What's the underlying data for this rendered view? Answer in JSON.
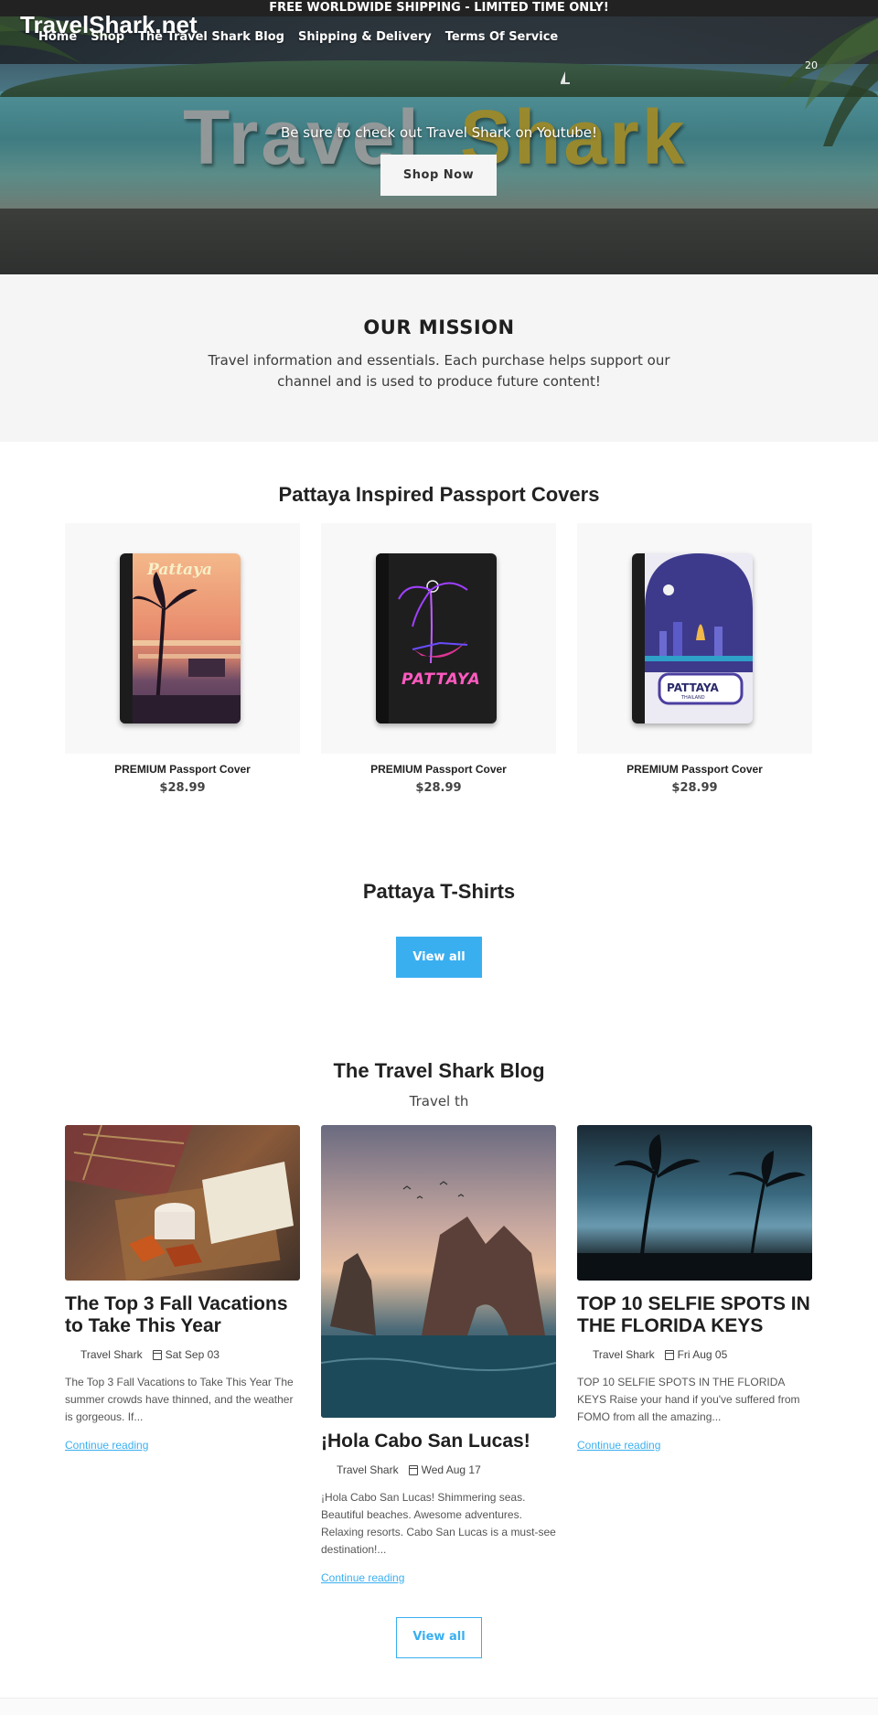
{
  "announcement": "FREE WORLDWIDE SHIPPING - LIMITED TIME ONLY!",
  "header": {
    "logo": "TravelShark.net",
    "nav": [
      "Home",
      "Shop",
      "The Travel Shark Blog",
      "Shipping & Delivery",
      "Terms Of Service"
    ],
    "cart_count": "20"
  },
  "hero": {
    "bg_text_1": "Travel",
    "bg_text_2": "Shark",
    "subtitle": "Be sure to check out Travel Shark on Youtube!",
    "button": "Shop Now"
  },
  "mission": {
    "title": "OUR MISSION",
    "text": "Travel information and essentials. Each purchase helps support our channel and is used to produce future content!"
  },
  "passport_section": {
    "title": "Pattaya Inspired Passport Covers",
    "products": [
      {
        "name": "PREMIUM Passport Cover",
        "price": "$28.99",
        "cover_text": "Pattaya"
      },
      {
        "name": "PREMIUM Passport Cover",
        "price": "$28.99",
        "cover_text": "PATTAYA"
      },
      {
        "name": "PREMIUM Passport Cover",
        "price": "$28.99",
        "cover_text": "PATTAYA",
        "cover_subtext": "THAILAND"
      }
    ]
  },
  "tshirt_section": {
    "title": "Pattaya T-Shirts",
    "button": "View all"
  },
  "blog_section": {
    "title": "The Travel Shark Blog",
    "subtitle": "Travel th",
    "posts": [
      {
        "title": "The Top 3 Fall Vacations to Take This Year",
        "author": "Travel Shark",
        "date": "Sat Sep 03",
        "excerpt": "The Top 3 Fall Vacations to Take This Year The summer crowds have thinned, and the weather is gorgeous. If...",
        "link": "Continue reading"
      },
      {
        "title": "¡Hola Cabo San Lucas!",
        "author": "Travel Shark",
        "date": "Wed Aug 17",
        "excerpt": "¡Hola Cabo San Lucas!   Shimmering seas. Beautiful beaches. Awesome adventures. Relaxing resorts. Cabo San Lucas is a must-see destination!...",
        "link": "Continue reading"
      },
      {
        "title": "TOP 10 SELFIE SPOTS IN THE FLORIDA KEYS",
        "author": "Travel Shark",
        "date": "Fri Aug 05",
        "excerpt": "TOP 10 SELFIE SPOTS IN THE FLORIDA KEYS Raise your hand if you've suffered from FOMO from all the amazing...",
        "link": "Continue reading"
      }
    ],
    "button": "View all"
  },
  "colors": {
    "accent": "#3aaff0",
    "announcement_bg": "#222222",
    "mission_bg": "#f5f5f5",
    "shark_gold": "#a08a27"
  }
}
